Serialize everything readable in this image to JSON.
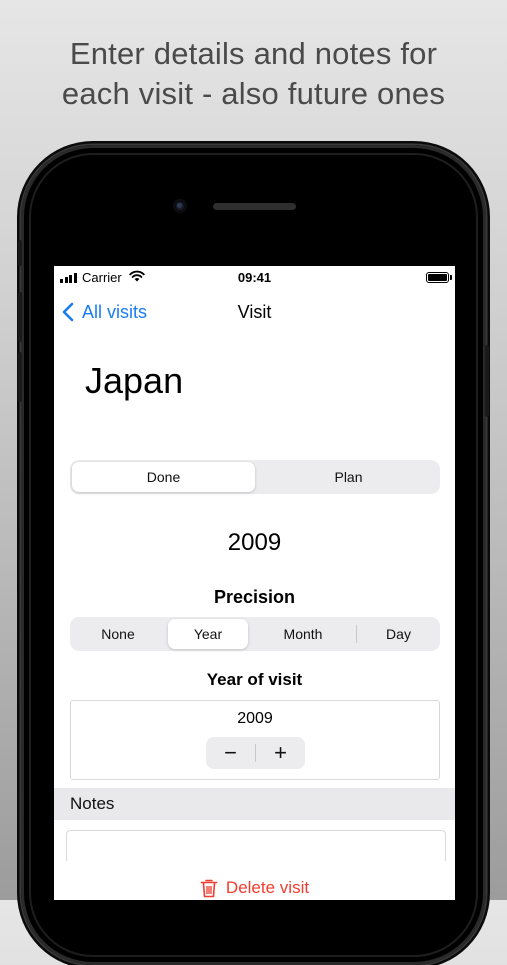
{
  "promo": {
    "line1": "Enter details and notes for",
    "line2": "each visit - also future ones"
  },
  "status_bar": {
    "carrier": "Carrier",
    "time": "09:41"
  },
  "nav": {
    "back_label": "All visits",
    "title": "Visit"
  },
  "visit": {
    "country": "Japan",
    "status_segments": [
      "Done",
      "Plan"
    ],
    "status_selected": "Done",
    "year_display": "2009",
    "precision_label": "Precision",
    "precision_segments": [
      "None",
      "Year",
      "Month",
      "Day"
    ],
    "precision_selected": "Year",
    "year_of_visit_label": "Year of visit",
    "year_value": "2009",
    "stepper": {
      "minus": "−",
      "plus": "+"
    }
  },
  "notes": {
    "header": "Notes"
  },
  "actions": {
    "delete_label": "Delete visit"
  },
  "colors": {
    "accent": "#1a7cf5",
    "destructive": "#f23c2f"
  }
}
